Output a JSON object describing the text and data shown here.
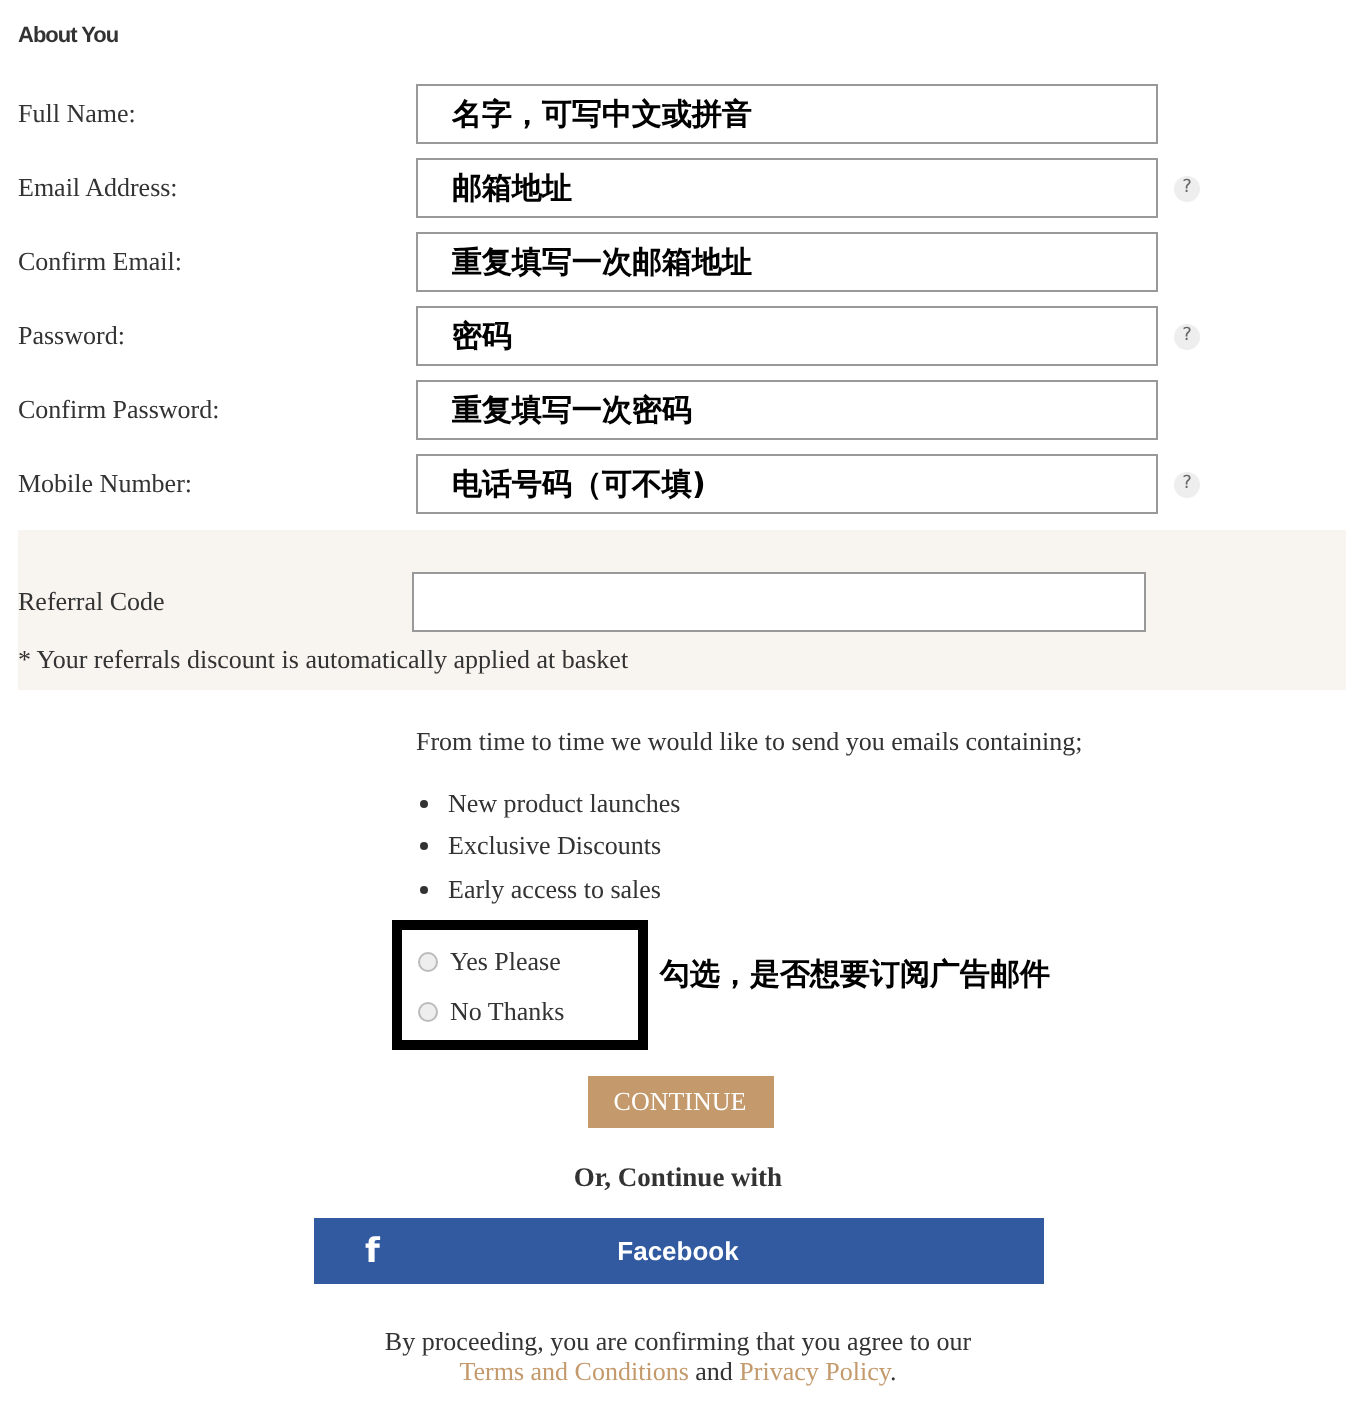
{
  "heading": "About You",
  "fields": [
    {
      "label": "Full Name:",
      "value": "名字，可写中文或拼音",
      "help": false
    },
    {
      "label": "Email Address:",
      "value": "邮箱地址",
      "help": true
    },
    {
      "label": "Confirm Email:",
      "value": "重复填写一次邮箱地址",
      "help": false
    },
    {
      "label": "Password:",
      "value": "密码",
      "help": true
    },
    {
      "label": "Confirm Password:",
      "value": "重复填写一次密码",
      "help": false
    },
    {
      "label": "Mobile Number:",
      "value": "电话号码（可不填)",
      "help": true
    }
  ],
  "help_icon": "?",
  "referral": {
    "label": "Referral Code",
    "note": "* Your referrals discount is automatically applied at basket"
  },
  "marketing": {
    "intro": "From time to time we would like to send you emails containing;",
    "items": [
      "New product launches",
      "Exclusive Discounts",
      "Early access to sales"
    ],
    "options": [
      {
        "label": "Yes Please",
        "selected": false
      },
      {
        "label": "No Thanks",
        "selected": false
      }
    ],
    "annotation": "勾选，是否想要订阅广告邮件"
  },
  "continue_button": "CONTINUE",
  "or_text": "Or, Continue with",
  "facebook_button": {
    "icon": "f",
    "label": "Facebook"
  },
  "footer": {
    "before": "By proceeding, you are confirming that you agree to our ",
    "terms": "Terms and Conditions",
    "middle": " and ",
    "privacy": "Privacy Policy",
    "after": "."
  }
}
